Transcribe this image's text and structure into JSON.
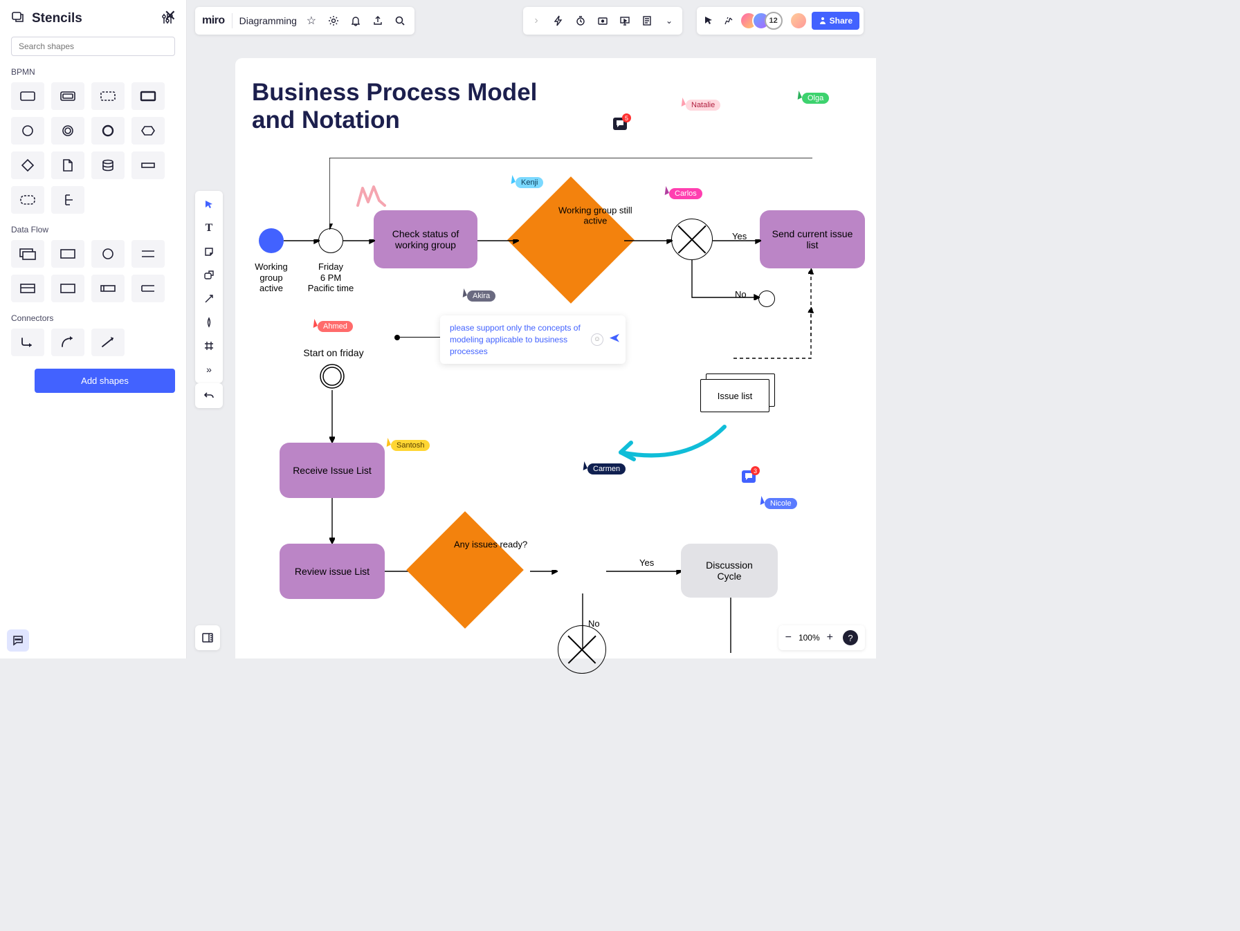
{
  "sidebar": {
    "title": "Stencils",
    "search_placeholder": "Search shapes",
    "add_shapes": "Add shapes",
    "categories": {
      "bpmn": "BPMN",
      "dataflow": "Data Flow",
      "connectors": "Connectors"
    }
  },
  "header": {
    "logo": "miro",
    "board_name": "Diagramming",
    "share": "Share",
    "user_count": "12"
  },
  "zoom": {
    "level": "100%"
  },
  "canvas": {
    "title_line1": "Business Process Model",
    "title_line2": "and Notation",
    "nodes": {
      "start_label": "Working\ngroup\nactive",
      "timer_label": "Friday\n6 PM\nPacific time",
      "check_status": "Check status of working group",
      "decision_active": "Working group still active",
      "send_list": "Send current issue list",
      "issue_list": "Issue list",
      "start_friday": "Start on friday",
      "receive_list": "Receive Issue List",
      "review_list": "Review issue List",
      "decision_ready": "Any issues ready?",
      "discussion": "Discussion Cycle"
    },
    "edge_labels": {
      "yes1": "Yes",
      "no1": "No",
      "yes2": "Yes",
      "no2": "No"
    },
    "comment_text": "please support only the concepts of modeling applicable to business processes",
    "comment_badge1_count": "5",
    "comment_badge2_count": "3"
  },
  "users": {
    "natalie": "Natalie",
    "olga": "Olga",
    "kenji": "Kenji",
    "carlos": "Carlos",
    "akira": "Akira",
    "ahmed": "Ahmed",
    "santosh": "Santosh",
    "carmen": "Carmen",
    "nicole": "Nicole"
  }
}
